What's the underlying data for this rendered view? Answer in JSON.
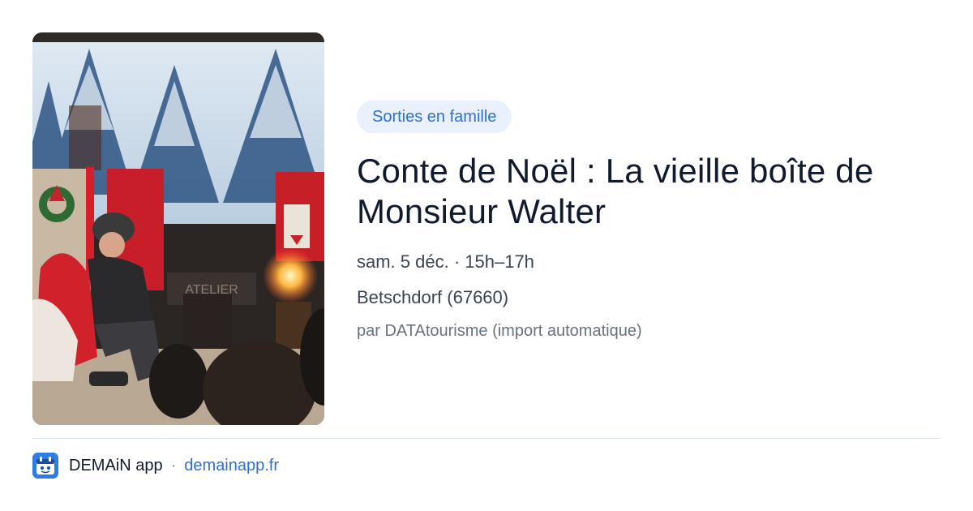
{
  "event": {
    "category": "Sorties en famille",
    "title": "Conte de Noël : La vieille boîte de Monsieur Walter",
    "date_time": "sam. 5 déc. · 15h–17h",
    "location": "Betschdorf (67660)",
    "source": "par DATAtourisme (import automatique)"
  },
  "photo": {
    "sign_text": "ATELIER"
  },
  "footer": {
    "app_name": "DEMAiN app",
    "separator": "·",
    "link": "demainapp.fr",
    "icon": "demain-app-icon"
  },
  "colors": {
    "badge_bg": "#e8f1fd",
    "accent": "#2f6fd1",
    "title": "#111a2c"
  }
}
